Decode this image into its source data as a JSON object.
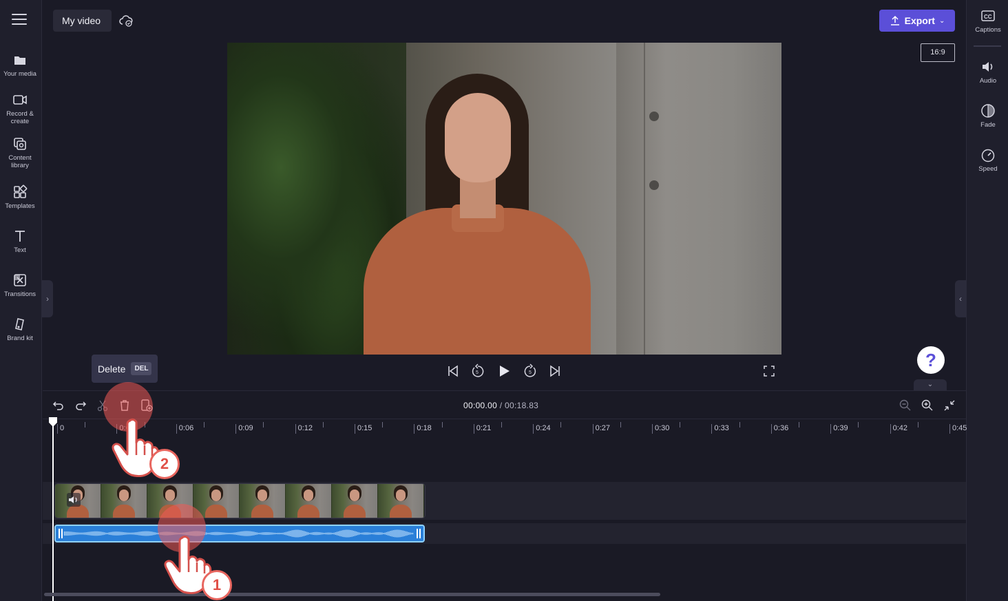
{
  "project": {
    "title": "My video"
  },
  "left_nav": [
    {
      "id": "your-media",
      "label": "Your media",
      "icon": "folder-icon"
    },
    {
      "id": "record-create",
      "label": "Record &\ncreate",
      "icon": "camera-icon"
    },
    {
      "id": "content-library",
      "label": "Content\nlibrary",
      "icon": "library-icon"
    },
    {
      "id": "templates",
      "label": "Templates",
      "icon": "templates-icon"
    },
    {
      "id": "text",
      "label": "Text",
      "icon": "text-icon"
    },
    {
      "id": "transitions",
      "label": "Transitions",
      "icon": "transitions-icon"
    },
    {
      "id": "brand-kit",
      "label": "Brand kit",
      "icon": "brand-kit-icon"
    }
  ],
  "right_nav": [
    {
      "id": "captions",
      "label": "Captions",
      "icon": "captions-icon"
    },
    {
      "id": "audio",
      "label": "Audio",
      "icon": "speaker-icon"
    },
    {
      "id": "fade",
      "label": "Fade",
      "icon": "fade-icon"
    },
    {
      "id": "speed",
      "label": "Speed",
      "icon": "speedometer-icon"
    }
  ],
  "header": {
    "export_label": "Export",
    "aspect_ratio": "16:9"
  },
  "tooltip": {
    "label": "Delete",
    "shortcut": "DEL"
  },
  "playback": {
    "current_time": "00:00.00",
    "total_time": " / 00:18.83"
  },
  "ruler_labels": [
    "0",
    "0:03",
    "0:06",
    "0:09",
    "0:12",
    "0:15",
    "0:18",
    "0:21",
    "0:24",
    "0:27",
    "0:30",
    "0:33",
    "0:36",
    "0:39",
    "0:42",
    "0:45"
  ],
  "help": {
    "label": "?"
  },
  "tutorial_steps": [
    "1",
    "2"
  ],
  "colors": {
    "accent": "#5b4fd8",
    "audio_clip": "#2a7fd8",
    "audio_border": "#8fd1ff",
    "step": "#e8665f"
  }
}
